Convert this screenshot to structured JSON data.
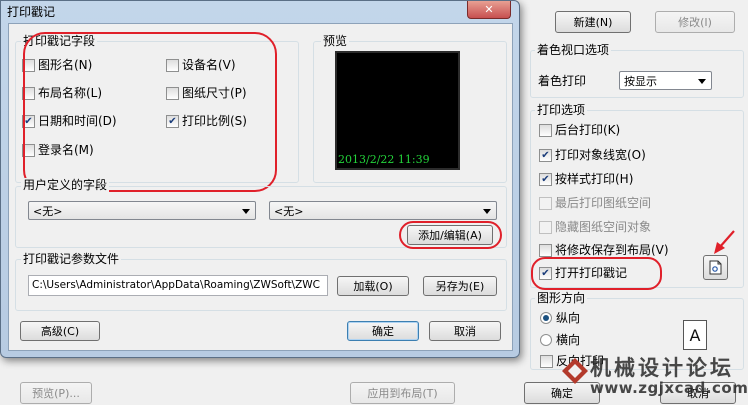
{
  "parent": {
    "new_button": "新建(N)",
    "modify_button": "修改(I)",
    "shaded_viewport_title": "着色视口选项",
    "shade_plot_label": "着色打印",
    "shade_plot_value": "按显示",
    "plot_options_title": "打印选项",
    "plot_options": [
      {
        "label": "后台打印(K)",
        "checked": false,
        "disabled": false
      },
      {
        "label": "打印对象线宽(O)",
        "checked": true,
        "disabled": false
      },
      {
        "label": "按样式打印(H)",
        "checked": true,
        "disabled": false
      },
      {
        "label": "最后打印图纸空间",
        "checked": false,
        "disabled": true
      },
      {
        "label": "隐藏图纸空间对象",
        "checked": false,
        "disabled": true
      },
      {
        "label": "将修改保存到布局(V)",
        "checked": false,
        "disabled": false
      },
      {
        "label": "打开打印戳记",
        "checked": true,
        "disabled": false
      }
    ],
    "orientation_title": "图形方向",
    "orientation_options": [
      {
        "label": "纵向",
        "selected": true
      },
      {
        "label": "横向",
        "selected": false
      }
    ],
    "upside_down_label": "反向打印",
    "orientation_letter": "A",
    "preview_button": "预览(P)...",
    "apply_layout_button": "应用到布局(T)",
    "ok_button": "确定",
    "cancel_button": "取消"
  },
  "dialog": {
    "title": "打印戳记",
    "close_glyph": "✕",
    "fields_group_title": "打印戳记字段",
    "fields": [
      {
        "label": "图形名(N)",
        "checked": false
      },
      {
        "label": "设备名(V)",
        "checked": false
      },
      {
        "label": "布局名称(L)",
        "checked": false
      },
      {
        "label": "图纸尺寸(P)",
        "checked": false
      },
      {
        "label": "日期和时间(D)",
        "checked": true
      },
      {
        "label": "打印比例(S)",
        "checked": true
      },
      {
        "label": "登录名(M)",
        "checked": false
      }
    ],
    "preview_title": "预览",
    "preview_text": "2013/2/22 11:39",
    "user_fields_title": "用户定义的字段",
    "user_field_1": "<无>",
    "user_field_2": "<无>",
    "add_edit_button": "添加/编辑(A)",
    "param_file_title": "打印戳记参数文件",
    "param_file_path": "C:\\Users\\Administrator\\AppData\\Roaming\\ZWSoft\\ZWC",
    "load_button": "加载(O)",
    "save_as_button": "另存为(E)",
    "advanced_button": "高级(C)",
    "ok_button": "确定",
    "cancel_button": "取消"
  },
  "watermark": {
    "text_cn": "机械设计论坛",
    "text_url": "www.zgjxcad.com"
  },
  "colors": {
    "highlight_red": "#e0202a",
    "preview_bg": "#000000",
    "preview_text": "#23d23a",
    "close_red": "#c75050"
  }
}
